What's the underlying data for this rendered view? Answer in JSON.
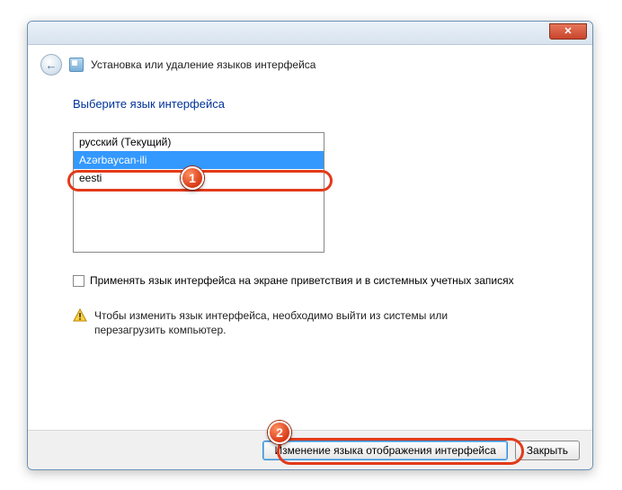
{
  "window": {
    "title": "Установка или удаление языков интерфейса",
    "close_glyph": "✕"
  },
  "back_glyph": "←",
  "heading": "Выберите язык интерфейса",
  "languages": {
    "items": [
      {
        "label": "русский (Текущий)",
        "selected": false
      },
      {
        "label": "Azərbaycan-ili",
        "selected": true
      },
      {
        "label": "eesti",
        "selected": false
      }
    ]
  },
  "checkbox": {
    "label": "Применять язык интерфейса на экране приветствия и в системных учетных записях",
    "checked": false
  },
  "warning": {
    "text": "Чтобы изменить язык интерфейса, необходимо выйти из системы или перезагрузить компьютер."
  },
  "buttons": {
    "primary": "Изменение языка отображения интерфейса",
    "close": "Закрыть"
  },
  "annotations": {
    "marker1": "1",
    "marker2": "2"
  }
}
